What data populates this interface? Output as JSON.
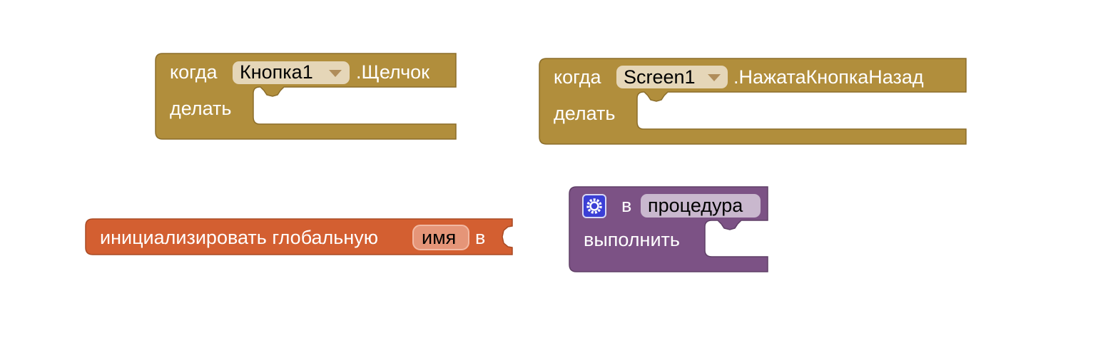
{
  "blocks": {
    "button_click": {
      "when_label": "когда",
      "component": "Кнопка1",
      "event": ".Щелчок",
      "do_label": "делать",
      "color": "#b18e3c"
    },
    "screen_back": {
      "when_label": "когда",
      "component": "Screen1",
      "event": ".НажатаКнопкаНазад",
      "do_label": "делать",
      "color": "#b18e3c"
    },
    "init_global": {
      "label": "инициализировать глобальную",
      "name": "имя",
      "to_label": "в",
      "color": "#d35f31"
    },
    "procedure": {
      "to_label": "в",
      "name": "процедура",
      "do_label": "выполнить",
      "color": "#7c5285",
      "gear_icon": "gear-icon"
    }
  }
}
